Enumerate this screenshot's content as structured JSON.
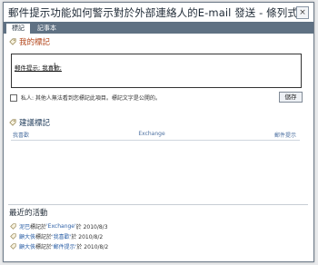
{
  "dialog": {
    "title": "郵件提示功能如何警示對於外部連絡人的E-mail 發送 - 條列式",
    "close_label": "×"
  },
  "tabs": [
    {
      "label": "標記",
      "active": true
    },
    {
      "label": "記事本",
      "active": false
    }
  ],
  "my_tags": {
    "heading": "我的標記",
    "value": "郵件提示; 我喜歡;"
  },
  "private": {
    "label": "私人: 其他人無法看到您標記此項目。標記文字是公開的。",
    "checked": false
  },
  "save_label": "儲存",
  "suggested": {
    "heading": "建議標記",
    "items": [
      "我喜歡",
      "Exchange",
      "郵件提示"
    ]
  },
  "recent": {
    "heading": "最近的活動",
    "items": [
      {
        "user": "泥巴",
        "verb": "標記於",
        "tag": "'Exchange'",
        "date": "於 2010/8/3"
      },
      {
        "user": "顧大俠",
        "verb": "標記於",
        "tag": "'我喜歡'",
        "date": "於 2010/8/2"
      },
      {
        "user": "顧大俠",
        "verb": "標記於",
        "tag": "'郵件提示'",
        "date": "於 2010/8/2"
      }
    ]
  },
  "colors": {
    "tabbar": "#5f7183",
    "link": "#2b5fa6",
    "accent_heading": "#b3461b"
  }
}
